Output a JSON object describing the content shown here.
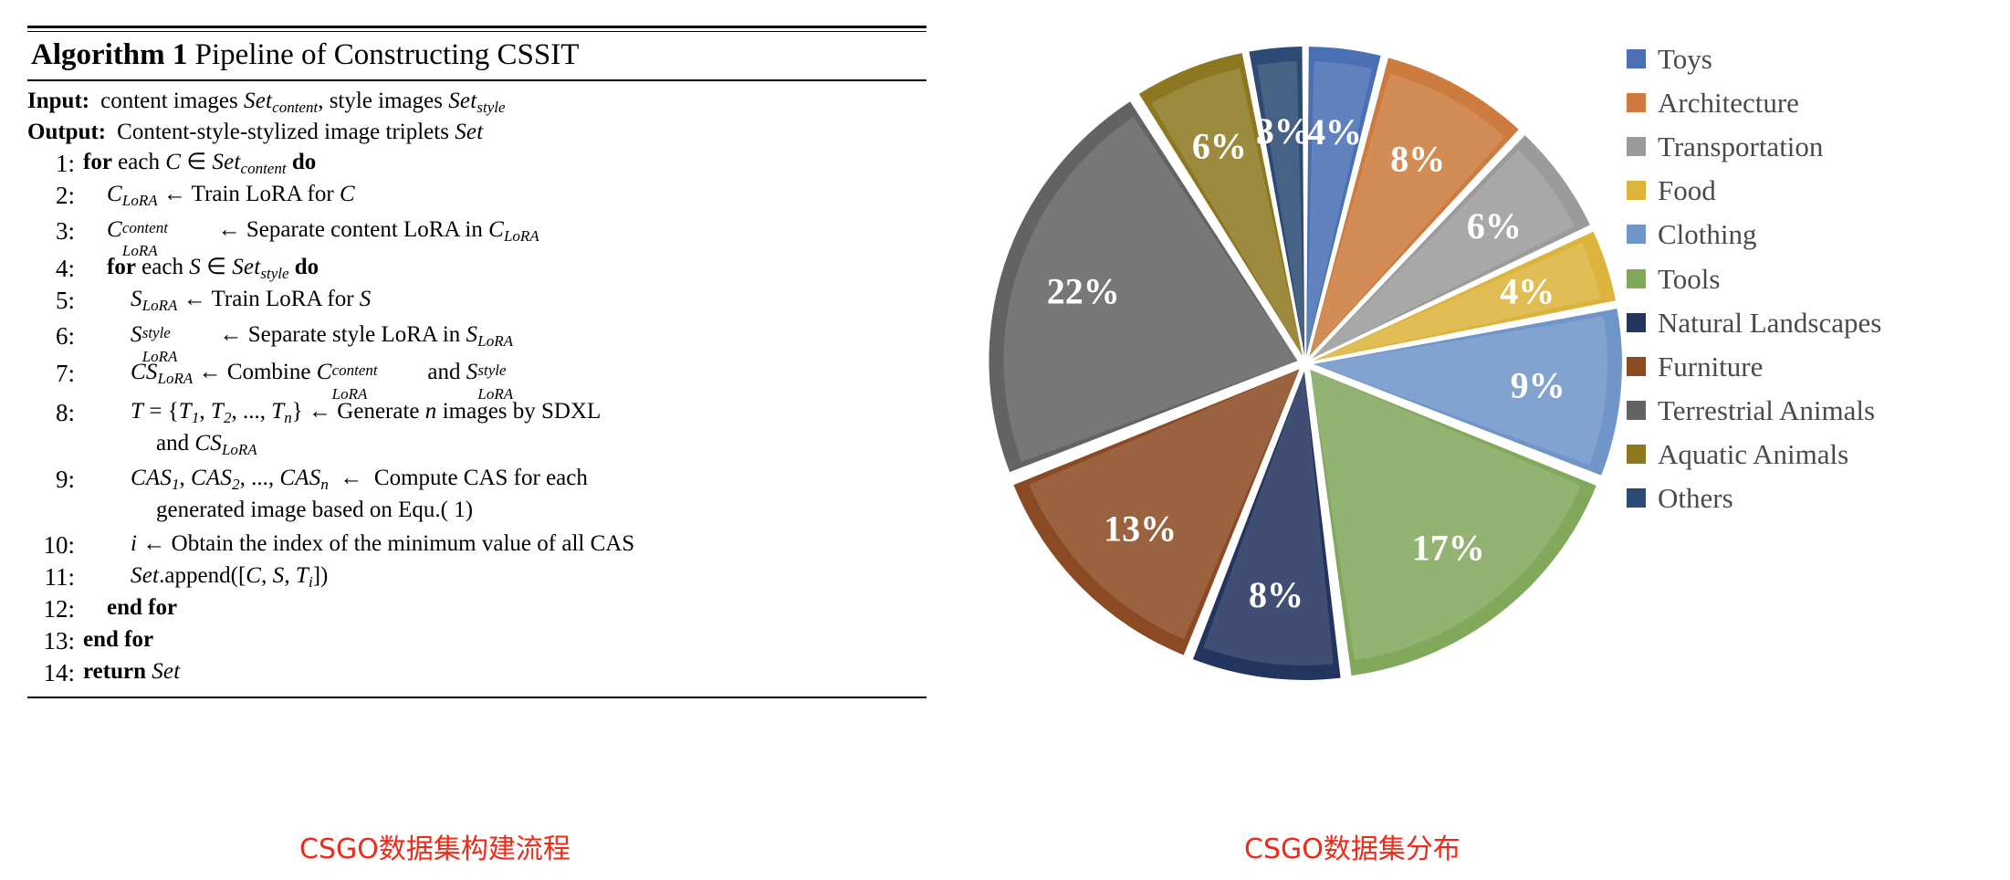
{
  "algorithm": {
    "title_bold": "Algorithm 1",
    "title_rest": "Pipeline of Constructing CSSIT",
    "io": [
      {
        "label": "Input:",
        "text_pre": "content images ",
        "set1": "Set",
        "set1_sub": "content",
        "mid": ", style images ",
        "set2": "Set",
        "set2_sub": "style"
      },
      {
        "label": "Output:",
        "text_pre": "Content-style-stylized image triplets ",
        "set1": "Set",
        "set1_sub": "",
        "mid": "",
        "set2": "",
        "set2_sub": ""
      }
    ],
    "lines": [
      {
        "num": "1:",
        "indent": 0,
        "text": "for each C ∈ Set_content do"
      },
      {
        "num": "2:",
        "indent": 1,
        "text": "C_LoRA ← Train LoRA for C"
      },
      {
        "num": "3:",
        "indent": 1,
        "text": "C^content_LoRA ← Separate content LoRA in C_LoRA"
      },
      {
        "num": "4:",
        "indent": 1,
        "text": "for each S ∈ Set_style do"
      },
      {
        "num": "5:",
        "indent": 2,
        "text": "S_LoRA ← Train LoRA for S"
      },
      {
        "num": "6:",
        "indent": 2,
        "text": "S^style_LoRA ← Separate style LoRA in S_LoRA"
      },
      {
        "num": "7:",
        "indent": 2,
        "text": "CS_LoRA ← Combine C^content_LoRA and S^style_LoRA"
      },
      {
        "num": "8:",
        "indent": 2,
        "text": "T = {T_1, T_2, ..., T_n} ← Generate n images by SDXL and CS_LoRA"
      },
      {
        "num": "9:",
        "indent": 2,
        "text": "CAS_1, CAS_2, ..., CAS_n ← Compute CAS for each generated image based on Equ.( 1)"
      },
      {
        "num": "10:",
        "indent": 2,
        "text": "i ← Obtain the index of the minimum value of all CAS"
      },
      {
        "num": "11:",
        "indent": 2,
        "text": "Set.append([C, S, T_i])"
      },
      {
        "num": "12:",
        "indent": 1,
        "text": "end for"
      },
      {
        "num": "13:",
        "indent": 0,
        "text": "end for"
      },
      {
        "num": "14:",
        "indent": 0,
        "text": "return Set"
      }
    ],
    "words": {
      "for": "for",
      "each": "each",
      "do": "do",
      "end_for": "end for",
      "return": "return",
      "train_lora_for": "Train LoRA for",
      "separate_content": "Separate content LoRA in",
      "separate_style": "Separate style LoRA in",
      "combine": "Combine",
      "and": "and",
      "generate": "Generate",
      "images_by_sdxl": "images by SDXL",
      "compute_cas": "Compute CAS for each",
      "generated_based": "generated image based on Equ.( 1)",
      "obtain_index": "Obtain the index of the minimum value of all CAS",
      "append": ".append(",
      "arrow": "←",
      "in_sym": "∈"
    }
  },
  "captions": {
    "left": "CSGO数据集构建流程",
    "right": "CSGO数据集分布"
  },
  "chart_data": {
    "type": "pie",
    "title": "CSGO数据集分布",
    "legend_position": "right",
    "labels_on_slices": true,
    "label_format": "percent",
    "categories": [
      "Toys",
      "Architecture",
      "Transportation",
      "Food",
      "Clothing",
      "Tools",
      "Natural Landscapes",
      "Furniture",
      "Terrestrial Animals",
      "Aquatic Animals",
      "Others"
    ],
    "values": [
      4,
      8,
      6,
      4,
      9,
      17,
      8,
      13,
      22,
      6,
      3
    ],
    "value_labels": [
      "4%",
      "8%",
      "6%",
      "4%",
      "9%",
      "17%",
      "8%",
      "13%",
      "22%",
      "6%",
      "3%"
    ],
    "colors": [
      "#4a6fb5",
      "#cd7b3e",
      "#9b9b9b",
      "#dcb43c",
      "#6f95c9",
      "#82a85c",
      "#23345e",
      "#8c4a24",
      "#636363",
      "#8d7821",
      "#2c4a73"
    ],
    "start_angle_deg": 0,
    "exploded": true,
    "label_color": "#ffffff"
  },
  "legend": {
    "items": [
      {
        "label": "Toys",
        "color": "#4a6fb5"
      },
      {
        "label": "Architecture",
        "color": "#cd7b3e"
      },
      {
        "label": "Transportation",
        "color": "#9b9b9b"
      },
      {
        "label": "Food",
        "color": "#dcb43c"
      },
      {
        "label": "Clothing",
        "color": "#6f95c9"
      },
      {
        "label": "Tools",
        "color": "#82a85c"
      },
      {
        "label": "Natural Landscapes",
        "color": "#23345e"
      },
      {
        "label": "Furniture",
        "color": "#8c4a24"
      },
      {
        "label": "Terrestrial Animals",
        "color": "#636363"
      },
      {
        "label": "Aquatic Animals",
        "color": "#8d7821"
      },
      {
        "label": "Others",
        "color": "#2c4a73"
      }
    ]
  }
}
